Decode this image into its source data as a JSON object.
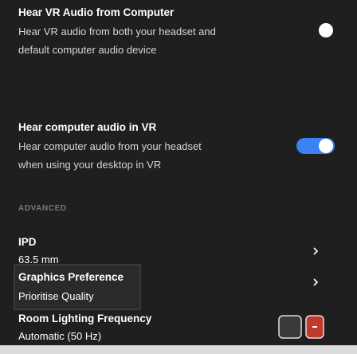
{
  "settings": {
    "hear_vr_audio": {
      "title": "Hear VR Audio from Computer",
      "description_line1": "Hear VR audio from both your headset and",
      "description_line2": "default computer audio device",
      "toggle_on": true
    },
    "hear_computer_audio": {
      "title": "Hear computer audio in VR",
      "description_line1": "Hear computer audio from your headset",
      "description_line2": "when using your desktop in VR",
      "toggle_on": true
    },
    "advanced_label": "ADVANCED",
    "ipd": {
      "title": "IPD",
      "value": "63.5 mm"
    },
    "graphics_preference": {
      "title": "Graphics Preference",
      "value": "Prioritise Quality"
    },
    "room_lighting": {
      "title": "Room Lighting Frequency",
      "value": "Automatic (50 Hz)"
    }
  },
  "colors": {
    "background": "#1f1f1f",
    "toggle_active": "#3b82f6",
    "text_primary": "#ffffff",
    "text_secondary": "#d6d6d6"
  },
  "icons": [
    "chevron-right-icon",
    "toggle-knob"
  ]
}
